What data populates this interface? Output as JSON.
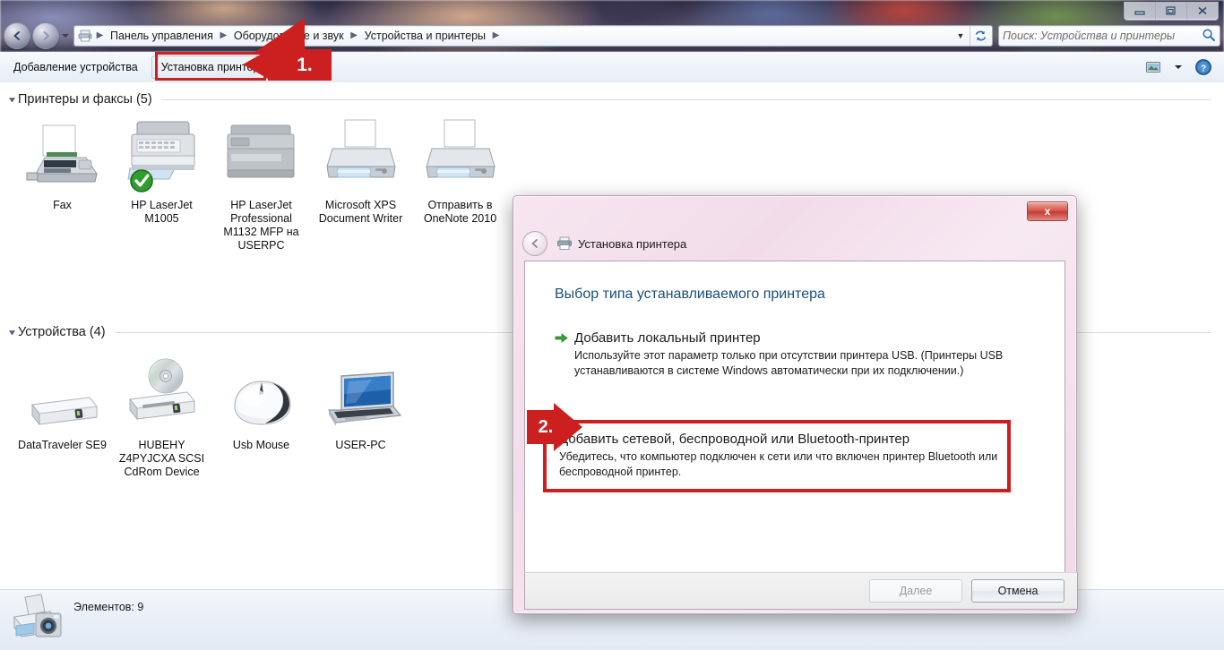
{
  "window": {
    "controls": [
      {
        "name": "minimize",
        "glyph": "minimize-icon"
      },
      {
        "name": "restore",
        "glyph": "restore-icon"
      },
      {
        "name": "close",
        "glyph": "close-icon"
      }
    ]
  },
  "addressbar": {
    "back_tooltip": "Назад",
    "forward_tooltip": "Вперед",
    "crumbs": [
      "Панель управления",
      "Оборудование и звук",
      "Устройства и принтеры"
    ],
    "separator": "▶",
    "chevron": "▼",
    "refresh": "↻"
  },
  "search": {
    "placeholder": "Поиск: Устройства и принтеры"
  },
  "toolbar": {
    "add_device_label": "Добавление устройства",
    "install_printer_label": "Установка принтера",
    "view_icon": "view-pane-icon",
    "view_chevron": "▼",
    "help_icon": "help-icon"
  },
  "sections": [
    {
      "id": "printers",
      "label": "Принтеры и факсы (5)",
      "items": [
        {
          "label": "Fax",
          "icon": "fax-icon",
          "default": false
        },
        {
          "label": "HP LaserJet M1005",
          "icon": "printer-mfp-icon",
          "default": true
        },
        {
          "label": "HP LaserJet Professional M1132 MFP на USERPC",
          "icon": "printer-network-icon",
          "default": false
        },
        {
          "label": "Microsoft XPS Document Writer",
          "icon": "printer-icon",
          "default": false
        },
        {
          "label": "Отправить в OneNote 2010",
          "icon": "printer-icon",
          "default": false
        }
      ]
    },
    {
      "id": "devices",
      "label": "Устройства (4)",
      "items": [
        {
          "label": "DataTraveler SE9",
          "icon": "usb-drive-icon"
        },
        {
          "label": "HUBEHY Z4PYJCXA SCSI CdRom Device",
          "icon": "cdrom-drive-icon"
        },
        {
          "label": "Usb Mouse",
          "icon": "mouse-icon"
        },
        {
          "label": "USER-PC",
          "icon": "laptop-icon"
        }
      ]
    }
  ],
  "statusbar": {
    "icon": "printer-camera-icon",
    "text": "Элементов: 9"
  },
  "dialog": {
    "close_label": "x",
    "title": "Установка принтера",
    "title_icon": "printer-icon",
    "back_glyph": "◄",
    "heading": "Выбор типа устанавливаемого принтера",
    "options": [
      {
        "id": "local",
        "arrow": "➜",
        "title": "Добавить локальный принтер",
        "desc": "Используйте этот параметр только при отсутствии принтера USB. (Принтеры USB устанавливаются в системе Windows автоматически при их подключении.)"
      },
      {
        "id": "network",
        "title": "Добавить сетевой, беспроводной или Bluetooth-принтер",
        "desc": "Убедитесь, что компьютер подключен к сети или что включен принтер Bluetooth или беспроводной принтер."
      }
    ],
    "next_label": "Далее",
    "cancel_label": "Отмена"
  },
  "annotations": [
    {
      "id": "step-1",
      "label": "1.",
      "color": "#cc1f1f"
    },
    {
      "id": "step-2",
      "label": "2.",
      "color": "#cc1f1f"
    }
  ],
  "colors": {
    "annotation_red": "#cc1f1f",
    "dialog_pink": "#f2dcea",
    "heading_blue": "#18507a",
    "default_check_green": "#2f9e2f"
  }
}
